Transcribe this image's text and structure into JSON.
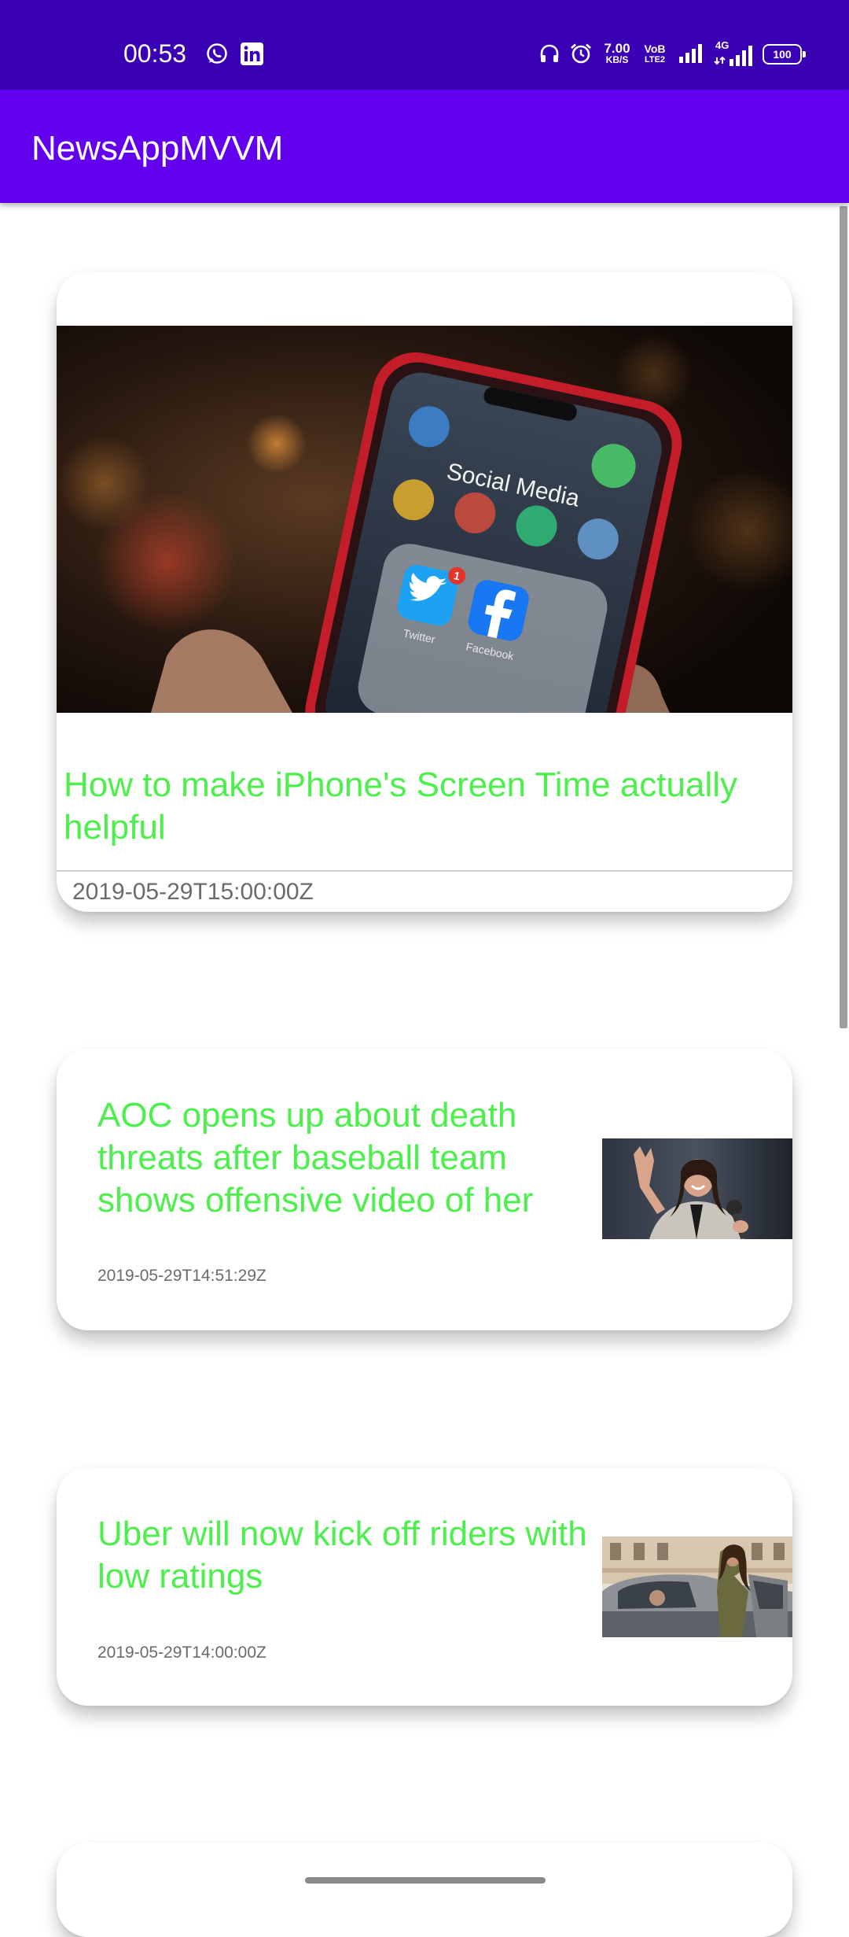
{
  "status_bar": {
    "time": "00:53",
    "net_speed_value": "7.00",
    "net_speed_unit": "KB/S",
    "volte_top": "VoB",
    "volte_bottom": "LTE2",
    "network_type": "4G",
    "battery": "100",
    "icons": [
      "whatsapp-icon",
      "linkedin-icon",
      "headphones-icon",
      "alarm-icon",
      "signal-icon",
      "signal-4g-icon",
      "battery-icon"
    ],
    "background": "#3a00b4"
  },
  "app_bar": {
    "title": "NewsAppMVVM",
    "background": "#6200ee"
  },
  "articles": [
    {
      "title": "How to make iPhone's Screen Time actually helpful",
      "date": "2019-05-29T15:00:00Z",
      "image_text": "Social Media",
      "app_labels": [
        "Twitter",
        "Facebook"
      ],
      "badge": "1"
    },
    {
      "title": "AOC opens up about death threats after baseball team shows offensive video of her",
      "date": "2019-05-29T14:51:29Z"
    },
    {
      "title": "Uber will now kick off riders with low ratings",
      "date": "2019-05-29T14:00:00Z"
    }
  ],
  "colors": {
    "headline": "#4cef4c",
    "date": "#6b6b6b"
  }
}
